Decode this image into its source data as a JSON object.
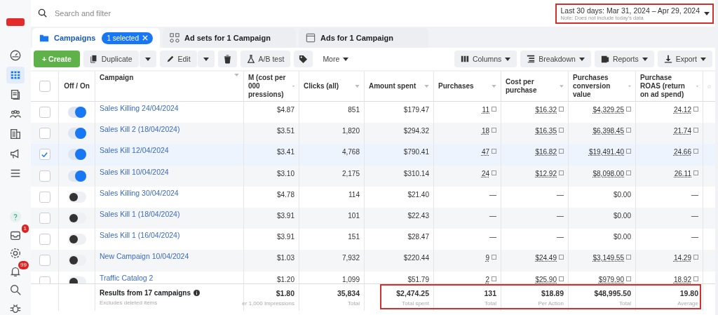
{
  "search": {
    "placeholder": "Search and filter"
  },
  "date_range": {
    "label": "Last 30 days: Mar 31, 2024 – Apr 29, 2024",
    "note": "Note: Does not include today's data",
    "highlighted": true
  },
  "sidebar": {
    "items": [
      {
        "selected": false
      },
      {
        "selected": true
      },
      {
        "selected": false
      },
      {
        "selected": false
      },
      {
        "selected": false
      },
      {
        "selected": false
      },
      {
        "selected": false
      }
    ],
    "bottom": [
      {
        "kind": "help"
      },
      {
        "kind": "inbox",
        "badge": "1"
      },
      {
        "kind": "gear"
      },
      {
        "kind": "bell",
        "badge": "99"
      },
      {
        "kind": "search"
      },
      {
        "kind": "bug"
      }
    ]
  },
  "tabs": [
    {
      "label": "Campaigns",
      "selected": true,
      "chip": "1 selected"
    },
    {
      "label": "Ad sets for 1 Campaign",
      "selected": false
    },
    {
      "label": "Ads for 1 Campaign",
      "selected": false
    }
  ],
  "toolbar": {
    "left": [
      {
        "kind": "create",
        "label": "+ Create"
      },
      {
        "kind": "split",
        "label": "Duplicate"
      },
      {
        "kind": "split",
        "label": "Edit"
      },
      {
        "kind": "icon"
      },
      {
        "kind": "plain",
        "label": "A/B test"
      },
      {
        "kind": "icon"
      },
      {
        "kind": "menu",
        "label": "More"
      }
    ],
    "right": [
      {
        "label": "Columns"
      },
      {
        "label": "Breakdown"
      },
      {
        "label": "Reports"
      },
      {
        "label": "Export"
      }
    ]
  },
  "table": {
    "select_all": {
      "checked": false
    },
    "columns": [
      "Off / On",
      "Campaign",
      "M (cost per 000 pressions)",
      "Clicks (all)",
      "Amount spent",
      "Purchases",
      "Cost per purchase",
      "Purchases conversion value",
      "Purchase ROAS (return on ad spend)"
    ],
    "rows": [
      {
        "selected": false,
        "on": true,
        "name": "Sales Killing 24/04/2024",
        "cells": [
          "$4.87",
          "851",
          "$179.47",
          "11",
          "$16.32",
          "$4,329.25",
          "24.12"
        ],
        "attributed": true
      },
      {
        "selected": false,
        "on": true,
        "name": "Sales Kill 2 (18/04/2024)",
        "cells": [
          "$3.51",
          "1,820",
          "$294.32",
          "18",
          "$16.35",
          "$6,398.45",
          "21.74"
        ],
        "attributed": true
      },
      {
        "selected": true,
        "on": true,
        "name": "Sales Kill 12/04/2024",
        "cells": [
          "$3.41",
          "4,768",
          "$790.41",
          "47",
          "$16.82",
          "$19,491.40",
          "24.66"
        ],
        "attributed": true
      },
      {
        "selected": false,
        "on": true,
        "name": "Sales Kill 10/04/2024",
        "cells": [
          "$3.10",
          "2,175",
          "$310.14",
          "24",
          "$12.92",
          "$8,098.00",
          "26.11"
        ],
        "attributed": true
      },
      {
        "selected": false,
        "on": false,
        "name": "Sales Killing 30/04/2024",
        "cells": [
          "$4.78",
          "114",
          "$21.40",
          "—",
          "—",
          "$0.00",
          "—"
        ],
        "attributed": false
      },
      {
        "selected": false,
        "on": false,
        "name": "Sales Kill 1 (18/04/2024)",
        "cells": [
          "$3.91",
          "101",
          "$22.43",
          "—",
          "—",
          "$0.00",
          "—"
        ],
        "attributed": false
      },
      {
        "selected": false,
        "on": false,
        "name": "Sales Kill 1 (16/04/2024)",
        "cells": [
          "$3.91",
          "151",
          "$28.47",
          "—",
          "—",
          "$0.00",
          "—"
        ],
        "attributed": false
      },
      {
        "selected": false,
        "on": false,
        "name": "New Campaign 10/04/2024",
        "cells": [
          "$1.03",
          "7,932",
          "$220.44",
          "9",
          "$24.49",
          "$3,149.55",
          "14.29"
        ],
        "attributed": true
      },
      {
        "selected": false,
        "on": false,
        "name": "Traffic Catalog 2",
        "cells": [
          "$1.20",
          "1,099",
          "$51.79",
          "2",
          "$25.90",
          "$979.90",
          "18.92"
        ],
        "attributed": true
      }
    ],
    "footer": {
      "title": "Results from 17 campaigns",
      "subtitle": "Excludes deleted items",
      "highlighted": true,
      "cells": [
        {
          "value": "$1.80",
          "sub": "er 1,000 Impressions"
        },
        {
          "value": "35,834",
          "sub": "Total"
        },
        {
          "value": "$2,474.25",
          "sub": "Total spent"
        },
        {
          "value": "131",
          "sub": "Total"
        },
        {
          "value": "$18.89",
          "sub": "Per Action"
        },
        {
          "value": "$48,995.50",
          "sub": "Total"
        },
        {
          "value": "19.80",
          "sub": "Average"
        }
      ]
    }
  }
}
